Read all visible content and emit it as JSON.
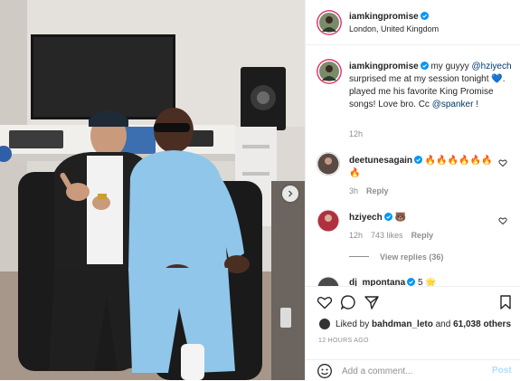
{
  "header": {
    "username": "iamkingpromise",
    "location": "London, United Kingdom"
  },
  "caption": {
    "username": "iamkingpromise",
    "part1": " my guyyy",
    "mention1": "@hziyech",
    "part2": " surprised me at my session tonight 💙. played me his favorite King Promise songs! Love bro. Cc ",
    "mention2": "@spanker",
    "part3": " !",
    "time": "12h"
  },
  "comments": [
    {
      "username": "deetunesagain",
      "text": "🔥🔥🔥🔥🔥🔥🔥",
      "time": "3h",
      "reply": "Reply"
    },
    {
      "username": "hziyech",
      "text": "🐻",
      "time": "12h",
      "likes": "743 likes",
      "reply": "Reply",
      "view_replies": "View replies (36)"
    },
    {
      "username": "dj_mpontana",
      "text": "5 🌟"
    }
  ],
  "likes": {
    "prefix": "Liked by ",
    "user": "bahdman_leto",
    "middle": " and ",
    "count": "61,038 others"
  },
  "time_ago": "12 HOURS AGO",
  "add_comment": {
    "placeholder": "Add a comment...",
    "post_label": "Post"
  },
  "colors": {
    "verified": "#0095f6",
    "link": "#00376b",
    "post_disabled": "#b3dbff"
  }
}
